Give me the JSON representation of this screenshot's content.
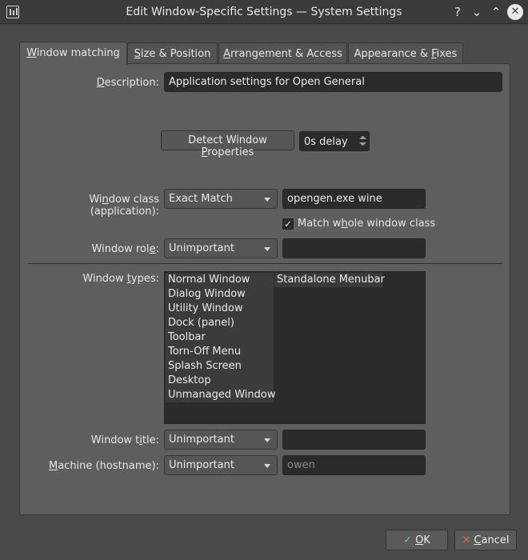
{
  "window": {
    "title": "Edit Window-Specific Settings — System Settings",
    "help": "?",
    "minimize": "⌄",
    "maximize": "⌃",
    "close": "✕"
  },
  "tabs": [
    {
      "label_u": "W",
      "label_rest": "indow matching"
    },
    {
      "label_u": "S",
      "label_rest": "ize & Position"
    },
    {
      "label_u": "A",
      "label_rest": "rrangement & Access"
    },
    {
      "label_pre": "Appearance & ",
      "label_u": "F",
      "label_rest": "ixes"
    }
  ],
  "description": {
    "label_u": "D",
    "label_rest": "escription:",
    "value": "Application settings for Open General"
  },
  "detect": {
    "label_pre": "Detect Window ",
    "label_u": "P",
    "label_rest": "roperties",
    "delay": "0s delay"
  },
  "window_class": {
    "label_pre": "Wi",
    "label_u": "n",
    "label_rest": "dow class (application):",
    "match": "Exact Match",
    "value": "opengen.exe wine",
    "whole_pre": "Match w",
    "whole_u": "h",
    "whole_rest": "ole window class",
    "check": "✓"
  },
  "window_role": {
    "label_pre": "Window rol",
    "label_u": "e",
    "label_rest": ":",
    "match": "Unimportant",
    "value": ""
  },
  "window_types": {
    "label_pre": "Window ",
    "label_u": "t",
    "label_rest": "ypes:",
    "col1": [
      "Normal Window",
      "Dialog Window",
      "Utility Window",
      "Dock (panel)",
      "Toolbar",
      "Torn-Off Menu",
      "Splash Screen",
      "Desktop",
      "Unmanaged Window"
    ],
    "col2": [
      "Standalone Menubar"
    ]
  },
  "window_title": {
    "label_pre": "Window t",
    "label_u": "i",
    "label_rest": "tle:",
    "match": "Unimportant",
    "value": ""
  },
  "machine": {
    "label_u": "M",
    "label_rest": "achine (hostname):",
    "match": "Unimportant",
    "placeholder": "owen"
  },
  "footer": {
    "ok_u": "O",
    "ok_rest": "K",
    "cancel_u": "C",
    "cancel_rest": "ancel"
  }
}
